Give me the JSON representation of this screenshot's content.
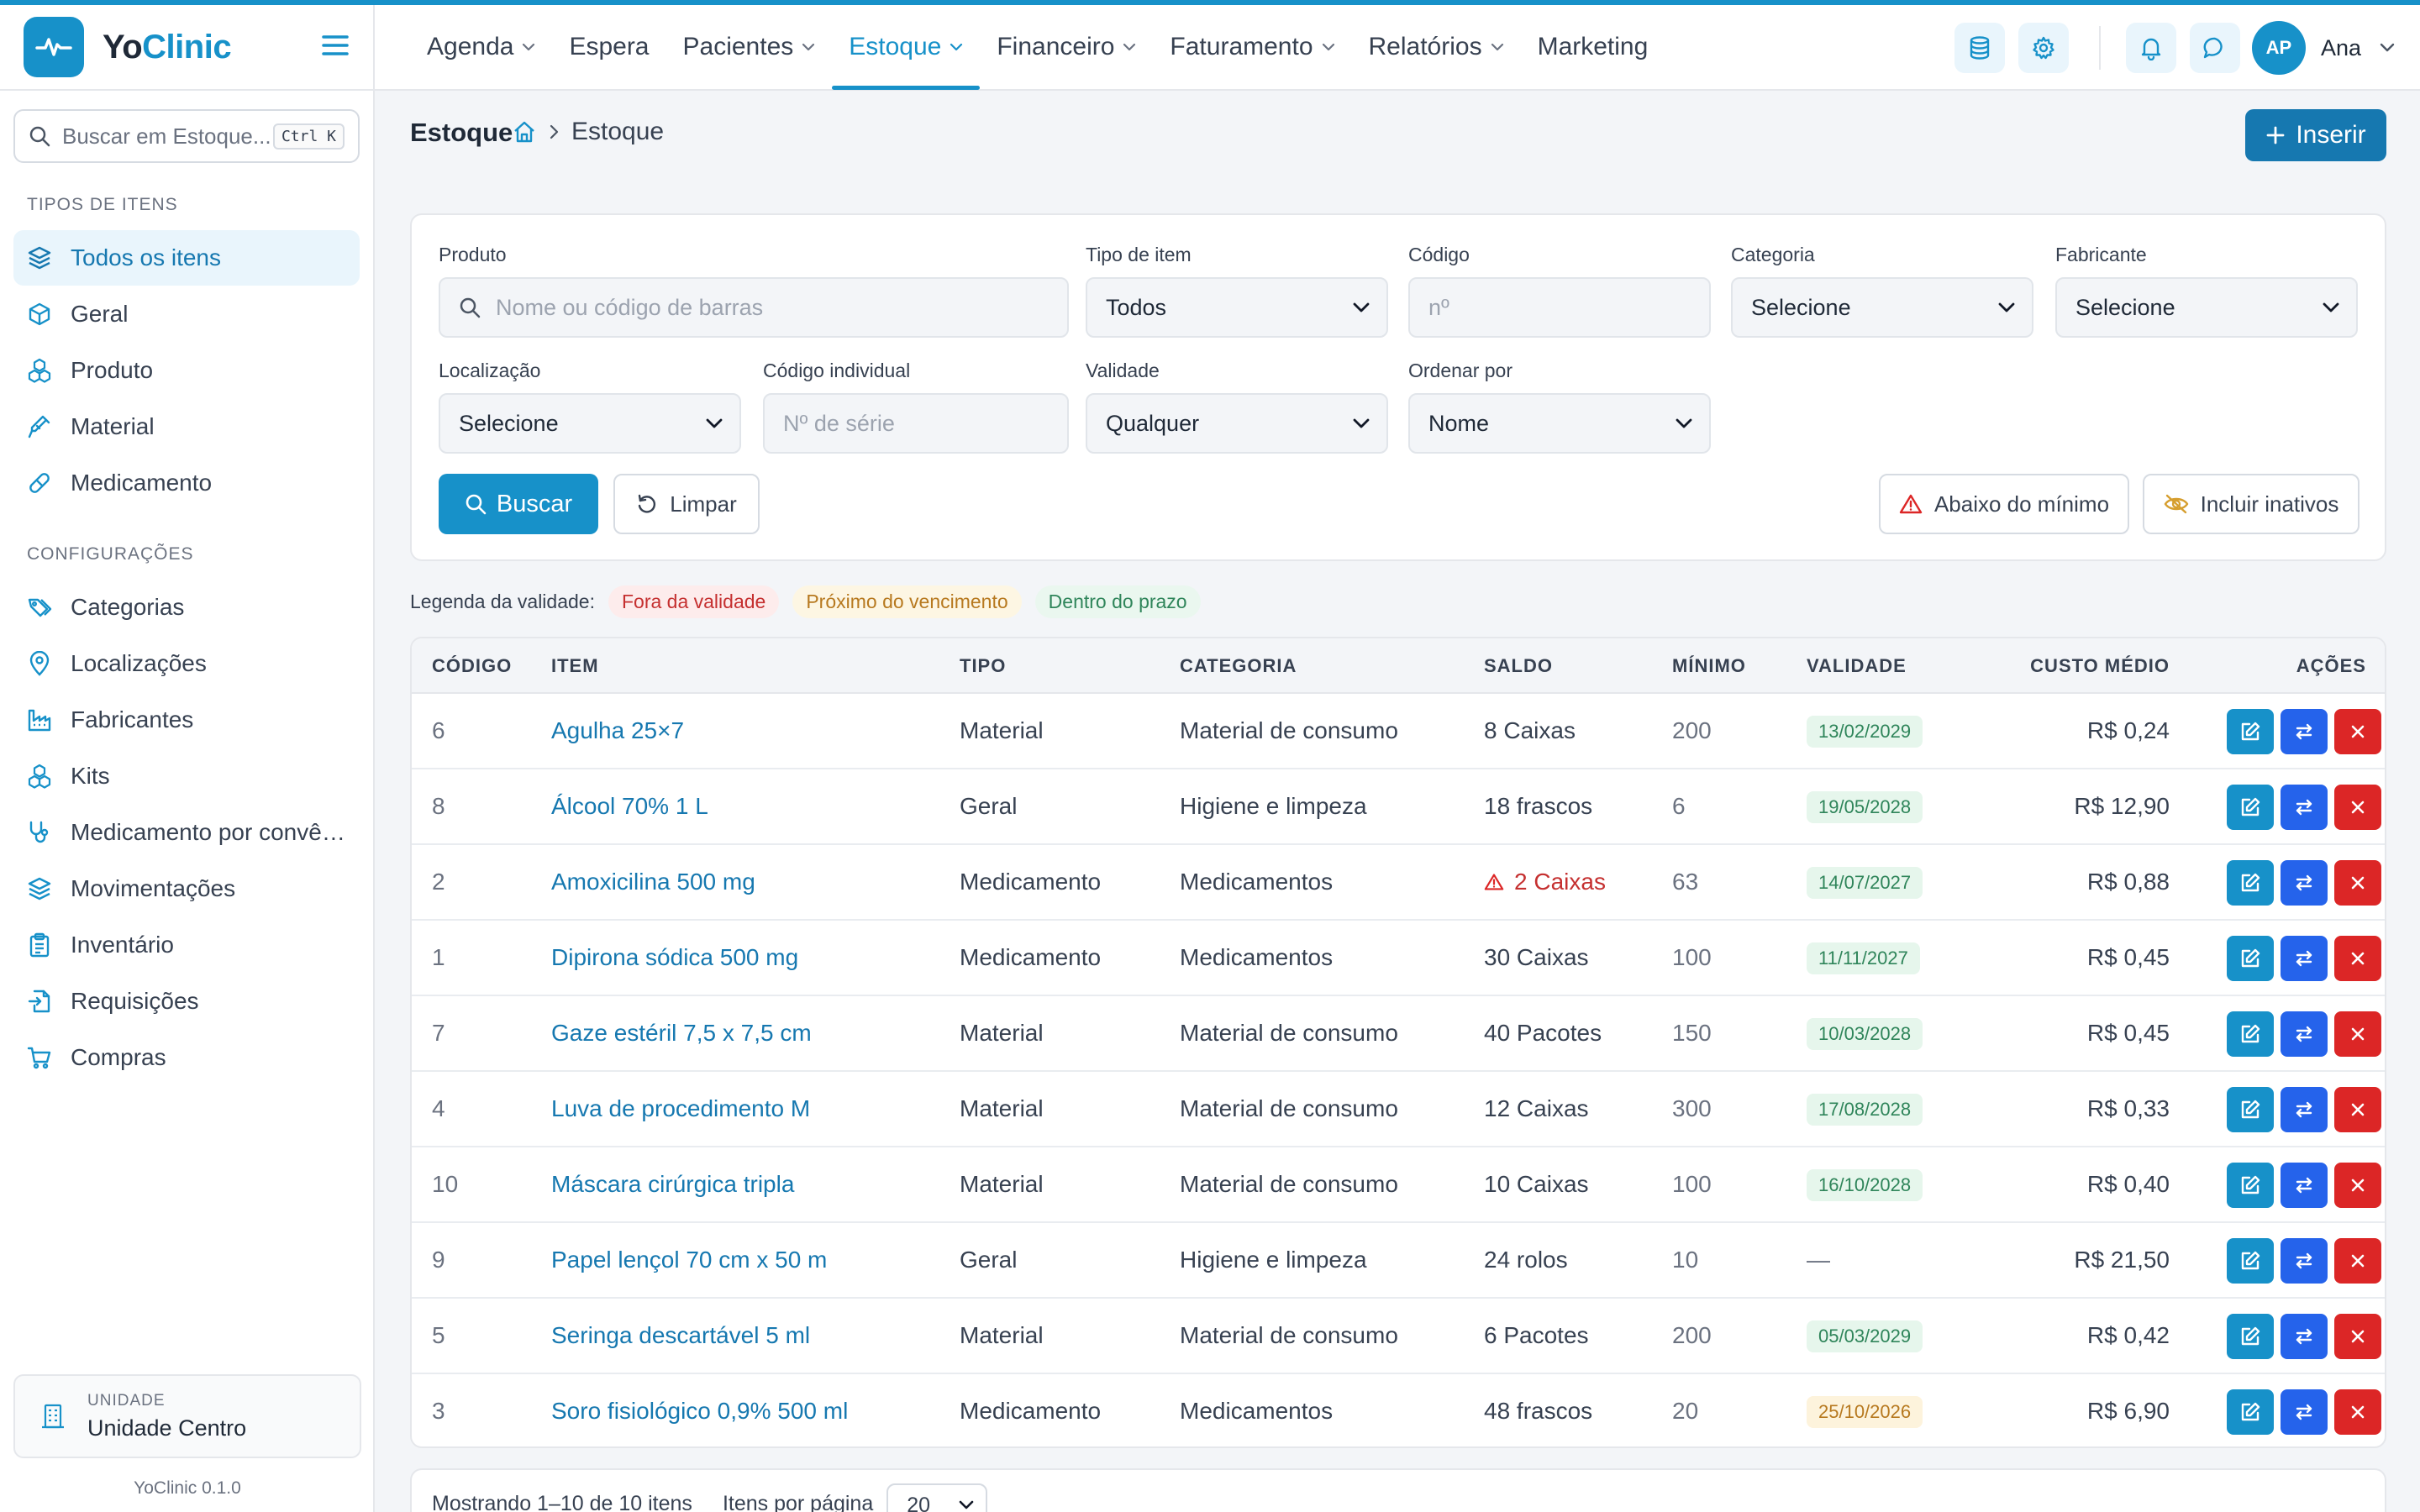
{
  "app": {
    "name_prefix": "Yo",
    "name_suffix": "Clinic",
    "version": "YoClinic 0.1.0"
  },
  "sidebar": {
    "search_placeholder": "Buscar em Estoque...",
    "search_shortcut": "Ctrl K",
    "sections": [
      {
        "title": "TIPOS DE ITENS",
        "items": [
          {
            "label": "Todos os itens",
            "icon": "stack-icon",
            "active": true
          },
          {
            "label": "Geral",
            "icon": "box-icon"
          },
          {
            "label": "Produto",
            "icon": "cubes-icon"
          },
          {
            "label": "Material",
            "icon": "syringe-icon"
          },
          {
            "label": "Medicamento",
            "icon": "pill-icon"
          }
        ]
      },
      {
        "title": "CONFIGURAÇÕES",
        "items": [
          {
            "label": "Categorias",
            "icon": "tags-icon"
          },
          {
            "label": "Localizações",
            "icon": "location-pin-icon"
          },
          {
            "label": "Fabricantes",
            "icon": "factory-icon"
          },
          {
            "label": "Kits",
            "icon": "cubes-icon"
          },
          {
            "label": "Medicamento por convênio",
            "icon": "stethoscope-icon"
          },
          {
            "label": "Movimentações",
            "icon": "stack-icon"
          },
          {
            "label": "Inventário",
            "icon": "clipboard-icon"
          },
          {
            "label": "Requisições",
            "icon": "file-import-icon"
          },
          {
            "label": "Compras",
            "icon": "cart-icon"
          }
        ]
      }
    ],
    "unit": {
      "label": "UNIDADE",
      "name": "Unidade Centro"
    }
  },
  "topnav": {
    "items": [
      {
        "label": "Agenda",
        "dropdown": true
      },
      {
        "label": "Espera",
        "dropdown": false
      },
      {
        "label": "Pacientes",
        "dropdown": true
      },
      {
        "label": "Estoque",
        "dropdown": true,
        "active": true
      },
      {
        "label": "Financeiro",
        "dropdown": true
      },
      {
        "label": "Faturamento",
        "dropdown": true
      },
      {
        "label": "Relatórios",
        "dropdown": true
      },
      {
        "label": "Marketing",
        "dropdown": false
      }
    ],
    "user": {
      "initials": "AP",
      "name": "Ana"
    }
  },
  "header": {
    "title": "Estoque",
    "breadcrumb": "Estoque",
    "insert_label": "Inserir"
  },
  "filters": {
    "produto": {
      "label": "Produto",
      "placeholder": "Nome ou código de barras"
    },
    "tipo": {
      "label": "Tipo de item",
      "value": "Todos"
    },
    "codigo": {
      "label": "Código",
      "placeholder": "nº"
    },
    "categoria": {
      "label": "Categoria",
      "value": "Selecione"
    },
    "fabricante": {
      "label": "Fabricante",
      "value": "Selecione"
    },
    "localizacao": {
      "label": "Localização",
      "value": "Selecione"
    },
    "codigo_individual": {
      "label": "Código individual",
      "placeholder": "Nº de série"
    },
    "validade": {
      "label": "Validade",
      "value": "Qualquer"
    },
    "ordenar": {
      "label": "Ordenar por",
      "value": "Nome"
    },
    "buscar_label": "Buscar",
    "limpar_label": "Limpar",
    "abaixo_label": "Abaixo do mínimo",
    "inativos_label": "Incluir inativos"
  },
  "legend": {
    "title": "Legenda da validade:",
    "expired": "Fora da validade",
    "near": "Próximo do vencimento",
    "ok": "Dentro do prazo"
  },
  "table": {
    "headers": [
      "CÓDIGO",
      "ITEM",
      "TIPO",
      "CATEGORIA",
      "SALDO",
      "MÍNIMO",
      "VALIDADE",
      "CUSTO MÉDIO",
      "AÇÕES"
    ],
    "rows": [
      {
        "code": "6",
        "item": "Agulha 25×7",
        "tipo": "Material",
        "categoria": "Material de consumo",
        "saldo": "8 Caixas",
        "low": false,
        "minimo": "200",
        "validade": "13/02/2029",
        "status": "green",
        "custo": "R$ 0,24"
      },
      {
        "code": "8",
        "item": "Álcool 70% 1 L",
        "tipo": "Geral",
        "categoria": "Higiene e limpeza",
        "saldo": "18 frascos",
        "low": false,
        "minimo": "6",
        "validade": "19/05/2028",
        "status": "green",
        "custo": "R$ 12,90"
      },
      {
        "code": "2",
        "item": "Amoxicilina 500 mg",
        "tipo": "Medicamento",
        "categoria": "Medicamentos",
        "saldo": "2 Caixas",
        "low": true,
        "minimo": "63",
        "validade": "14/07/2027",
        "status": "green",
        "custo": "R$ 0,88"
      },
      {
        "code": "1",
        "item": "Dipirona sódica 500 mg",
        "tipo": "Medicamento",
        "categoria": "Medicamentos",
        "saldo": "30 Caixas",
        "low": false,
        "minimo": "100",
        "validade": "11/11/2027",
        "status": "green",
        "custo": "R$ 0,45"
      },
      {
        "code": "7",
        "item": "Gaze estéril 7,5 x 7,5 cm",
        "tipo": "Material",
        "categoria": "Material de consumo",
        "saldo": "40 Pacotes",
        "low": false,
        "minimo": "150",
        "validade": "10/03/2028",
        "status": "green",
        "custo": "R$ 0,45"
      },
      {
        "code": "4",
        "item": "Luva de procedimento M",
        "tipo": "Material",
        "categoria": "Material de consumo",
        "saldo": "12 Caixas",
        "low": false,
        "minimo": "300",
        "validade": "17/08/2028",
        "status": "green",
        "custo": "R$ 0,33"
      },
      {
        "code": "10",
        "item": "Máscara cirúrgica tripla",
        "tipo": "Material",
        "categoria": "Material de consumo",
        "saldo": "10 Caixas",
        "low": false,
        "minimo": "100",
        "validade": "16/10/2028",
        "status": "green",
        "custo": "R$ 0,40"
      },
      {
        "code": "9",
        "item": "Papel lençol 70 cm x 50 m",
        "tipo": "Geral",
        "categoria": "Higiene e limpeza",
        "saldo": "24 rolos",
        "low": false,
        "minimo": "10",
        "validade": "—",
        "status": "none",
        "custo": "R$ 21,50"
      },
      {
        "code": "5",
        "item": "Seringa descartável 5 ml",
        "tipo": "Material",
        "categoria": "Material de consumo",
        "saldo": "6 Pacotes",
        "low": false,
        "minimo": "200",
        "validade": "05/03/2029",
        "status": "green",
        "custo": "R$ 0,42"
      },
      {
        "code": "3",
        "item": "Soro fisiológico 0,9% 500 ml",
        "tipo": "Medicamento",
        "categoria": "Medicamentos",
        "saldo": "48 frascos",
        "low": false,
        "minimo": "20",
        "validade": "25/10/2026",
        "status": "yellow",
        "custo": "R$ 6,90"
      }
    ]
  },
  "footer": {
    "showing": "Mostrando 1–10 de 10 itens",
    "per_page_label": "Itens por página",
    "per_page": "20"
  },
  "colors": {
    "brand": "#1791c9",
    "brand_dark": "#1678b0",
    "danger": "#dc2626",
    "move": "#2563eb"
  }
}
